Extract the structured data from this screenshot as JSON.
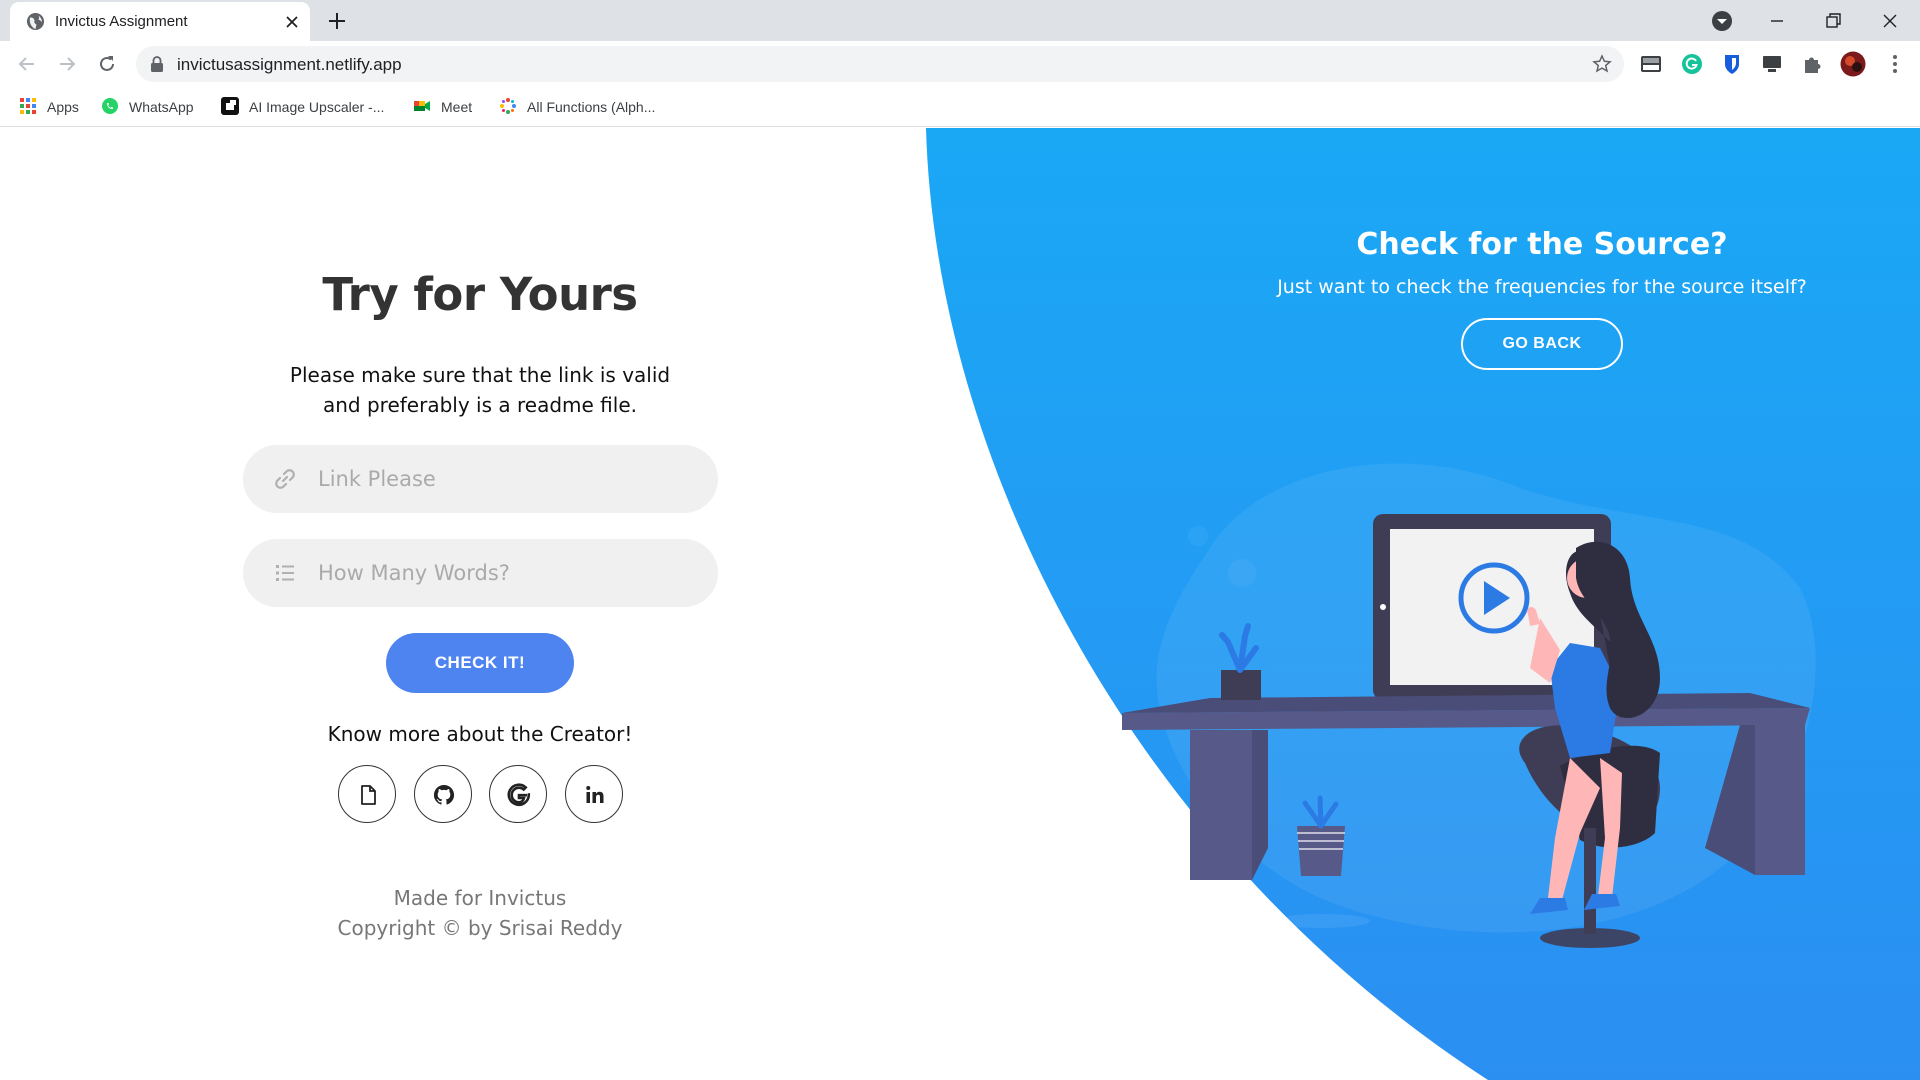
{
  "browser": {
    "tab_title": "Invictus Assignment",
    "url": "invictusassignment.netlify.app",
    "bookmarks": [
      {
        "label": "Apps",
        "icon": "apps-grid-icon"
      },
      {
        "label": "WhatsApp",
        "icon": "whatsapp-icon"
      },
      {
        "label": "AI Image Upscaler -...",
        "icon": "upscaler-icon"
      },
      {
        "label": "Meet",
        "icon": "meet-icon"
      },
      {
        "label": "All Functions (Alph...",
        "icon": "functions-icon"
      }
    ]
  },
  "form": {
    "heading": "Try for Yours",
    "subtext_line1": "Please make sure that the link is valid",
    "subtext_line2": "and preferably is a readme file.",
    "link_placeholder": "Link Please",
    "words_placeholder": "How Many Words?",
    "submit_label": "CHECK IT!",
    "creator_text": "Know more about the Creator!",
    "social": [
      "document-icon",
      "github-icon",
      "google-icon",
      "linkedin-icon"
    ],
    "footer_line1": "Made for Invictus",
    "footer_line2": "Copyright © by Srisai Reddy"
  },
  "panel": {
    "title": "Check for the Source?",
    "subtitle": "Just want to check the frequencies for the source itself?",
    "button_label": "GO BACK"
  },
  "colors": {
    "accent": "#4d84f0",
    "panel_blue_light": "#1aa8f5",
    "panel_blue_dark": "#2b8ff2",
    "heading": "#333333"
  }
}
